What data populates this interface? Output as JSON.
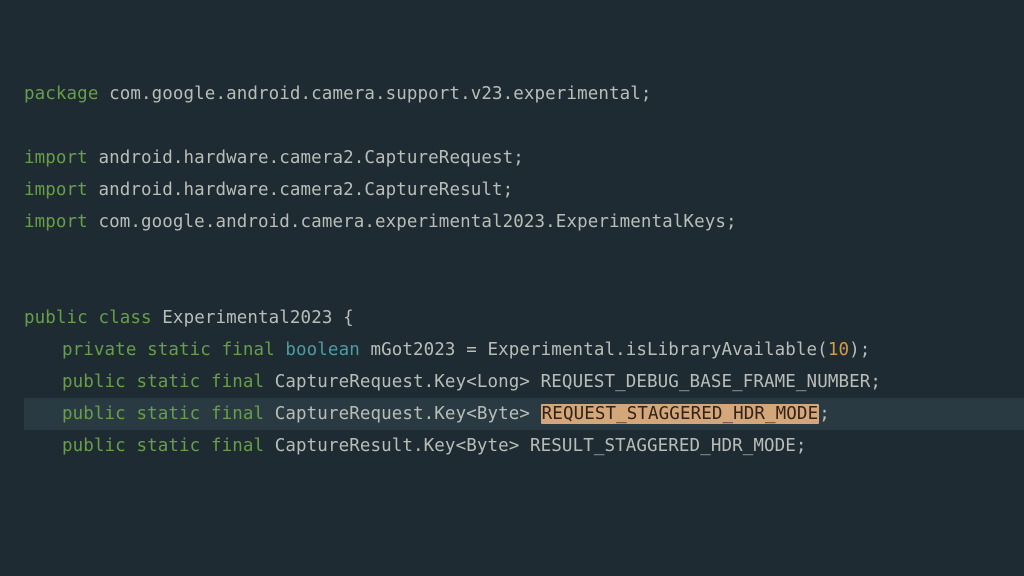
{
  "line1": {
    "kw": "package",
    "rest": " com.google.android.camera.support.v23.experimental;"
  },
  "line3": {
    "kw": "import",
    "rest": " android.hardware.camera2.CaptureRequest;"
  },
  "line4": {
    "kw": "import",
    "rest": " android.hardware.camera2.CaptureResult;"
  },
  "line5": {
    "kw": "import",
    "rest": " com.google.android.camera.experimental2023.ExperimentalKeys;"
  },
  "class_decl": {
    "kw_public": "public",
    "kw_class": "class",
    "name": " Experimental2023 {"
  },
  "field1": {
    "kw_private": "private",
    "kw_static": "static",
    "kw_final": "final",
    "type": "boolean",
    "rest1": " mGot2023 = Experimental.isLibraryAvailable(",
    "num": "10",
    "rest2": ");"
  },
  "field2": {
    "kw_public": "public",
    "kw_static": "static",
    "kw_final": "final",
    "rest": " CaptureRequest.Key<Long> REQUEST_DEBUG_BASE_FRAME_NUMBER;"
  },
  "field3": {
    "kw_public": "public",
    "kw_static": "static",
    "kw_final": "final",
    "rest_a": " CaptureRequest.Key<Byte> ",
    "sel": "REQUEST_STAGGERED_HDR_MODE",
    "rest_b": ";"
  },
  "field4": {
    "kw_public": "public",
    "kw_static": "static",
    "kw_final": "final",
    "rest": " CaptureResult.Key<Byte> RESULT_STAGGERED_HDR_MODE;"
  }
}
